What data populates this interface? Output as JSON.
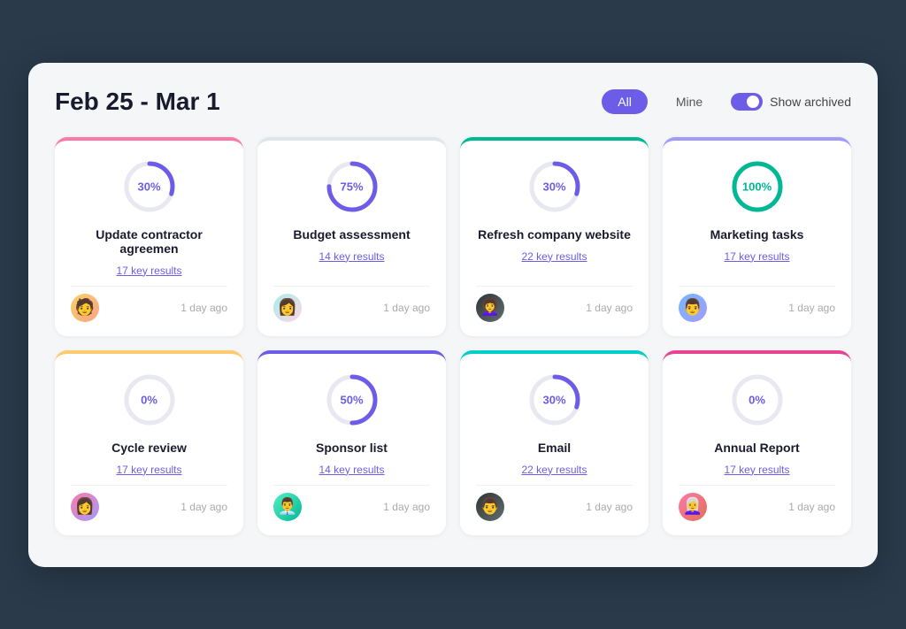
{
  "header": {
    "title": "Feb 25 - Mar 1",
    "filter_all": "All",
    "filter_mine": "Mine",
    "show_archived": "Show archived"
  },
  "cards": [
    {
      "id": "card-1",
      "border": "border-pink",
      "percent": 30,
      "percent_label": "30%",
      "title": "Update contractor agreemen",
      "key_results": "17 key results",
      "time": "1 day ago",
      "avatar_class": "av1",
      "avatar_emoji": "👤",
      "circle_color": "c-purple",
      "label_color": ""
    },
    {
      "id": "card-2",
      "border": "border-gray",
      "percent": 75,
      "percent_label": "75%",
      "title": "Budget assessment",
      "key_results": "14 key results",
      "time": "1 day ago",
      "avatar_class": "av2",
      "avatar_emoji": "👤",
      "circle_color": "c-purple",
      "label_color": ""
    },
    {
      "id": "card-3",
      "border": "border-green",
      "percent": 30,
      "percent_label": "30%",
      "title": "Refresh company website",
      "key_results": "22 key results",
      "time": "1 day ago",
      "avatar_class": "av3",
      "avatar_emoji": "👤",
      "circle_color": "c-purple",
      "label_color": ""
    },
    {
      "id": "card-4",
      "border": "border-purple",
      "percent": 100,
      "percent_label": "100%",
      "title": "Marketing tasks",
      "key_results": "17 key results",
      "time": "1 day ago",
      "avatar_class": "av4",
      "avatar_emoji": "👤",
      "circle_color": "c-green",
      "label_color": "label-green"
    },
    {
      "id": "card-5",
      "border": "border-yellow",
      "percent": 0,
      "percent_label": "0%",
      "title": "Cycle review",
      "key_results": "17 key results",
      "time": "1 day ago",
      "avatar_class": "av5",
      "avatar_emoji": "👤",
      "circle_color": "c-purple",
      "label_color": ""
    },
    {
      "id": "card-6",
      "border": "border-violet",
      "percent": 50,
      "percent_label": "50%",
      "title": "Sponsor list",
      "key_results": "14 key results",
      "time": "1 day ago",
      "avatar_class": "av6",
      "avatar_emoji": "👤",
      "circle_color": "c-purple",
      "label_color": ""
    },
    {
      "id": "card-7",
      "border": "border-cyan",
      "percent": 30,
      "percent_label": "30%",
      "title": "Email",
      "key_results": "22 key results",
      "time": "1 day ago",
      "avatar_class": "av7",
      "avatar_emoji": "👤",
      "circle_color": "c-purple",
      "label_color": ""
    },
    {
      "id": "card-8",
      "border": "border-magenta",
      "percent": 0,
      "percent_label": "0%",
      "title": "Annual Report",
      "key_results": "17 key results",
      "time": "1 day ago",
      "avatar_class": "av8",
      "avatar_emoji": "👤",
      "circle_color": "c-purple",
      "label_color": ""
    }
  ],
  "avatars": {
    "av1": "🧑",
    "av2": "👩",
    "av3": "👩‍🦱",
    "av4": "👨",
    "av5": "👩",
    "av6": "👨‍💼",
    "av7": "👨",
    "av8": "👩‍🦳"
  }
}
